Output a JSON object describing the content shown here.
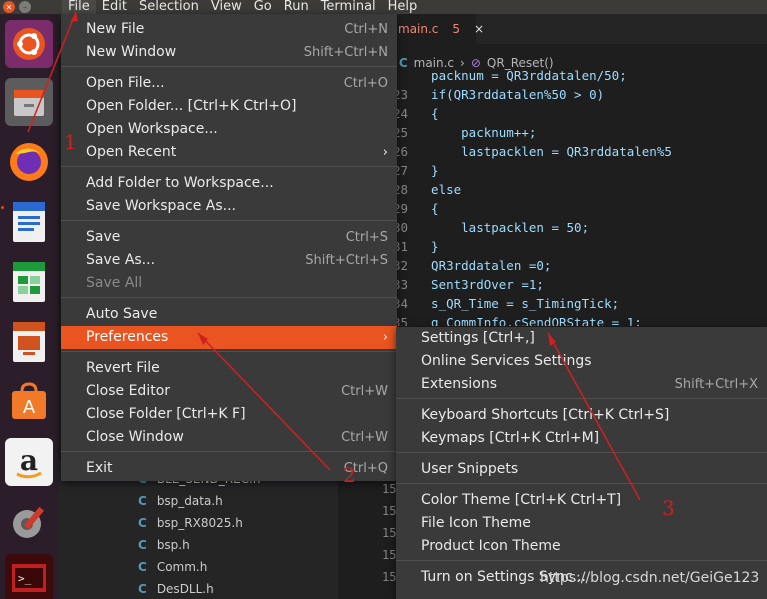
{
  "menubar": {
    "items": [
      "File",
      "Edit",
      "Selection",
      "View",
      "Go",
      "Run",
      "Terminal",
      "Help"
    ],
    "active": "File"
  },
  "launcher": {
    "apps": [
      "ubuntu-logo-icon",
      "files-icon",
      "firefox-icon",
      "writer-icon",
      "calc-icon",
      "impress-icon",
      "software-center-icon",
      "amazon-icon",
      "settings-icon",
      "terminal-icon"
    ]
  },
  "editor": {
    "tab": {
      "label": "main.c",
      "badge": "5",
      "close": "×"
    },
    "breadcrumb": {
      "sep": "›",
      "file": "main.c",
      "file_icon": "C",
      "function": "QR_Reset()"
    },
    "code_lines": [
      {
        "ln": "",
        "text": "  packnum = QR3rddatalen/50;"
      },
      {
        "ln": "23",
        "text": "  if(QR3rddatalen%50 > 0)"
      },
      {
        "ln": "24",
        "text": "  {"
      },
      {
        "ln": "25",
        "text": "      packnum++;"
      },
      {
        "ln": "26",
        "text": "      lastpacklen = QR3rddatalen%5"
      },
      {
        "ln": "27",
        "text": "  }"
      },
      {
        "ln": "28",
        "text": "  else"
      },
      {
        "ln": "29",
        "text": "  {"
      },
      {
        "ln": "30",
        "text": "      lastpacklen = 50;"
      },
      {
        "ln": "31",
        "text": "  }"
      },
      {
        "ln": "32",
        "text": "  QR3rddatalen =0;"
      },
      {
        "ln": "33",
        "text": "  Sent3rdOver =1;"
      },
      {
        "ln": "34",
        "text": "  s_QR_Time = s_TimingTick;"
      },
      {
        "ln": "35",
        "text": "  g_CommInfo.cSendQRState = 1;"
      }
    ],
    "explorer_files": [
      "BLE_SEND_REC.h",
      "bsp_data.h",
      "bsp_RX8025.h",
      "bsp.h",
      "Comm.h",
      "DesDLL.h"
    ],
    "explorer_file_icon": "C",
    "gutter_lines": [
      "15",
      "15",
      "15",
      "15",
      "15"
    ]
  },
  "file_menu": {
    "items": [
      {
        "label": "New File",
        "shortcut": "Ctrl+N"
      },
      {
        "label": "New Window",
        "shortcut": "Shift+Ctrl+N"
      },
      {
        "label": "Open File...",
        "shortcut": "Ctrl+O"
      },
      {
        "label": "Open Folder... [Ctrl+K Ctrl+O]",
        "shortcut": ""
      },
      {
        "label": "Open Workspace...",
        "shortcut": ""
      },
      {
        "label": "Open Recent",
        "shortcut": "›"
      },
      {
        "label": "Add Folder to Workspace...",
        "shortcut": ""
      },
      {
        "label": "Save Workspace As...",
        "shortcut": ""
      },
      {
        "label": "Save",
        "shortcut": "Ctrl+S"
      },
      {
        "label": "Save As...",
        "shortcut": "Shift+Ctrl+S"
      },
      {
        "label": "Save All",
        "shortcut": ""
      },
      {
        "label": "Auto Save",
        "shortcut": ""
      },
      {
        "label": "Preferences",
        "shortcut": "›"
      },
      {
        "label": "Revert File",
        "shortcut": ""
      },
      {
        "label": "Close Editor",
        "shortcut": "Ctrl+W"
      },
      {
        "label": "Close Folder [Ctrl+K F]",
        "shortcut": ""
      },
      {
        "label": "Close Window",
        "shortcut": "Ctrl+W"
      },
      {
        "label": "Exit",
        "shortcut": "Ctrl+Q"
      }
    ]
  },
  "preferences_menu": {
    "items": [
      {
        "label": "Settings [Ctrl+,]",
        "shortcut": ""
      },
      {
        "label": "Online Services Settings",
        "shortcut": ""
      },
      {
        "label": "Extensions",
        "shortcut": "Shift+Ctrl+X"
      },
      {
        "label": "Keyboard Shortcuts [Ctrl+K Ctrl+S]",
        "shortcut": ""
      },
      {
        "label": "Keymaps [Ctrl+K Ctrl+M]",
        "shortcut": ""
      },
      {
        "label": "User Snippets",
        "shortcut": ""
      },
      {
        "label": "Color Theme [Ctrl+K Ctrl+T]",
        "shortcut": ""
      },
      {
        "label": "File Icon Theme",
        "shortcut": ""
      },
      {
        "label": "Product Icon Theme",
        "shortcut": ""
      },
      {
        "label": "Turn on Settings Sync...",
        "shortcut": ""
      }
    ]
  },
  "annotations": {
    "step1": "1",
    "step2": "2",
    "step3": "3",
    "color": "#d02020"
  },
  "watermark": "https://blog.csdn.net/GeiGe123",
  "colors": {
    "accent": "#e95420",
    "menu_bg": "#3a3a3a",
    "menubar_bg": "#3c3b37",
    "launcher_bg": "#2b1d2a"
  }
}
